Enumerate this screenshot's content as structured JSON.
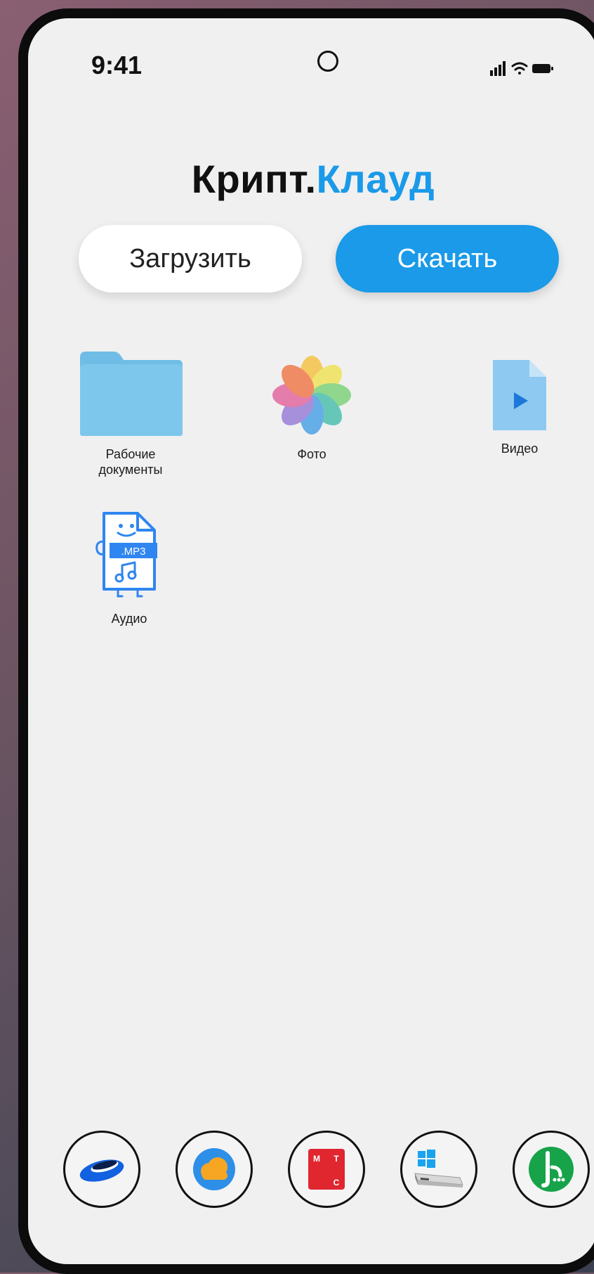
{
  "status": {
    "time": "9:41"
  },
  "brand": {
    "part1": "Крипт.",
    "part2": "Клауд"
  },
  "actions": {
    "upload_label": "Загрузить",
    "download_label": "Скачать"
  },
  "folders": [
    {
      "label_line1": "Рабочие",
      "label_line2": "документы",
      "icon": "folder-icon"
    },
    {
      "label": "Фото",
      "icon": "photos-icon"
    },
    {
      "label": "Видео",
      "icon": "video-file-icon"
    },
    {
      "label": "Аудио",
      "icon": "mp3-file-icon",
      "badge": ".MP3"
    }
  ],
  "dock": [
    {
      "icon": "yandex-disk-icon"
    },
    {
      "icon": "mail-cloud-icon"
    },
    {
      "icon": "mts-icon",
      "letters": [
        "М",
        "Т",
        "С"
      ]
    },
    {
      "icon": "windows-drive-icon"
    },
    {
      "icon": "megafon-icon"
    }
  ],
  "colors": {
    "accent": "#1a9ae8",
    "background": "#f0f0f1",
    "frame": "#0c0c0c"
  }
}
